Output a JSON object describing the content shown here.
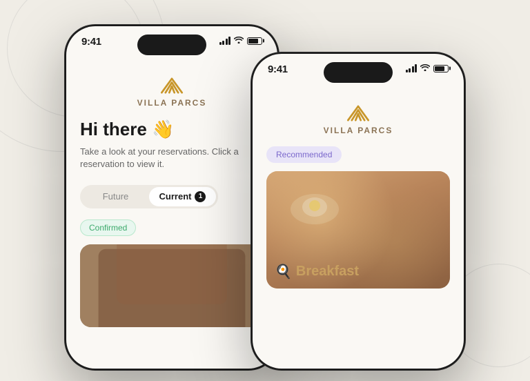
{
  "app": {
    "name": "Villa Parcs",
    "logo_text": "VILLA PARCS"
  },
  "phone_left": {
    "status_bar": {
      "time": "9:41",
      "signal": "signal",
      "wifi": "wifi",
      "battery": "battery"
    },
    "greeting": {
      "title": "Hi there 👋",
      "subtitle": "Take a look at your reservations. Click a reservation to view it."
    },
    "tabs": {
      "future_label": "Future",
      "current_label": "Current",
      "current_badge": "1"
    },
    "reservation": {
      "status": "Confirmed"
    }
  },
  "phone_right": {
    "status_bar": {
      "time": "9:41"
    },
    "recommendation": {
      "badge": "Recommended"
    },
    "food": {
      "category_emoji": "🍳",
      "category": "Breakfast"
    }
  }
}
